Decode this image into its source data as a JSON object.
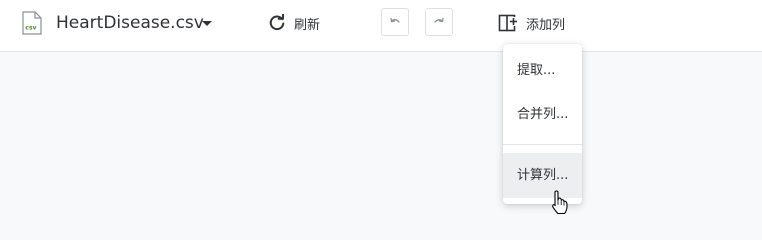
{
  "toolbar": {
    "file_icon_text": "csv",
    "file_name": "HeartDisease.csv",
    "refresh_label": "刷新",
    "add_column_label": "添加列"
  },
  "add_column_menu": {
    "items": [
      {
        "label": "提取..."
      },
      {
        "label": "合并列..."
      },
      {
        "label": "计算列..."
      }
    ],
    "hovered_item": "计算列..."
  },
  "icons": {
    "file": "csv-file-icon",
    "caret": "caret-down-icon",
    "refresh": "refresh-icon",
    "undo": "undo-icon",
    "redo": "redo-icon",
    "add_column": "add-column-icon",
    "cursor": "hand-cursor-icon"
  },
  "colors": {
    "file_icon_accent": "#4a8f3c",
    "text": "#2f3236",
    "background": "#f8f9fa",
    "hover": "#eceef0"
  }
}
